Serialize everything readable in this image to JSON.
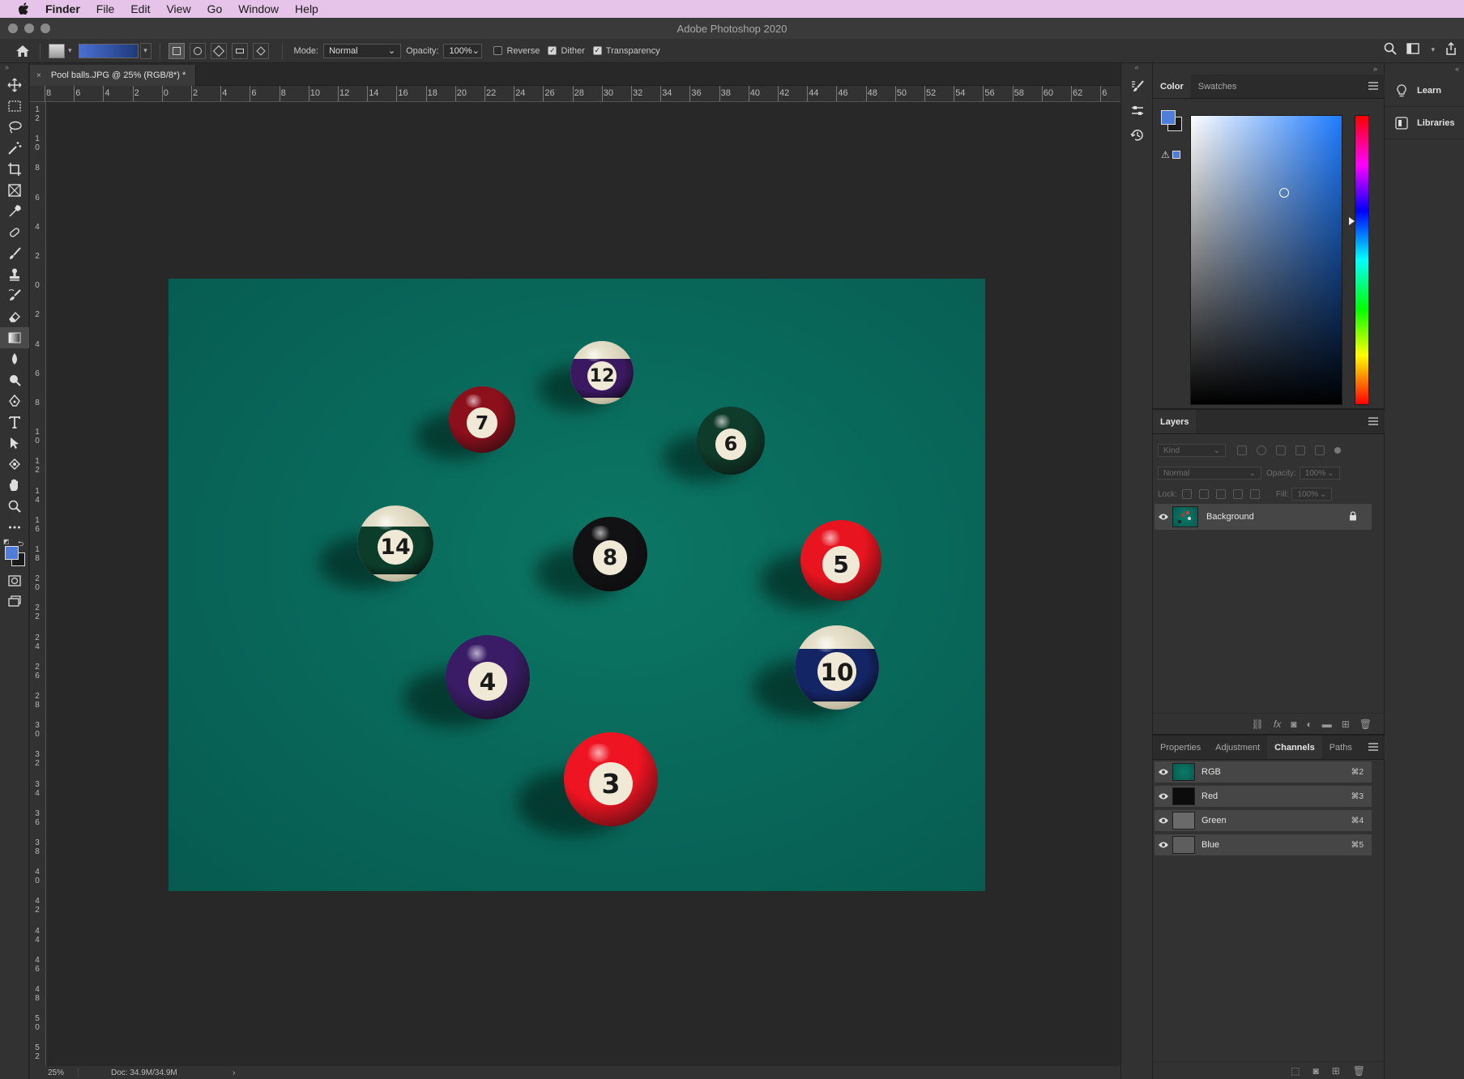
{
  "menubar": {
    "apple": "",
    "items": [
      "Finder",
      "File",
      "Edit",
      "View",
      "Go",
      "Window",
      "Help"
    ]
  },
  "window": {
    "title": "Adobe Photoshop 2020"
  },
  "options_bar": {
    "mode_label": "Mode:",
    "mode_value": "Normal",
    "opacity_label": "Opacity:",
    "opacity_value": "100%",
    "reverse_label": "Reverse",
    "reverse_checked": false,
    "dither_label": "Dither",
    "dither_checked": true,
    "transparency_label": "Transparency",
    "transparency_checked": true
  },
  "document": {
    "tab_title": "Pool balls.JPG @ 25% (RGB/8*) *",
    "close_glyph": "×"
  },
  "rulers": {
    "top": [
      "8",
      "6",
      "4",
      "2",
      "0",
      "2",
      "4",
      "6",
      "8",
      "10",
      "12",
      "14",
      "16",
      "18",
      "20",
      "22",
      "24",
      "26",
      "28",
      "30",
      "32",
      "34",
      "36",
      "38",
      "40",
      "42",
      "44",
      "46",
      "48",
      "50",
      "52",
      "54",
      "56",
      "58",
      "60",
      "62",
      "6"
    ],
    "left": [
      "12",
      "10",
      "8",
      "6",
      "4",
      "2",
      "0",
      "2",
      "4",
      "6",
      "8",
      "10",
      "12",
      "14",
      "16",
      "18",
      "20",
      "22",
      "24",
      "26",
      "28",
      "30",
      "32",
      "34",
      "36",
      "38",
      "40",
      "42",
      "44",
      "46",
      "48",
      "50",
      "52"
    ]
  },
  "image": {
    "balls": [
      {
        "number": "12",
        "type": "stripe",
        "color": "#3a1960"
      },
      {
        "number": "7",
        "type": "solid",
        "color": "#8c0f1c"
      },
      {
        "number": "6",
        "type": "solid",
        "color": "#0f3b2a"
      },
      {
        "number": "14",
        "type": "stripe",
        "color": "#0b3d2a"
      },
      {
        "number": "8",
        "type": "solid",
        "color": "#121214"
      },
      {
        "number": "5",
        "type": "solid",
        "color": "#e8141f"
      },
      {
        "number": "4",
        "type": "solid",
        "color": "#3a1c66"
      },
      {
        "number": "10",
        "type": "stripe",
        "color": "#142566"
      },
      {
        "number": "3",
        "type": "solid",
        "color": "#ef1422"
      }
    ]
  },
  "status": {
    "zoom": "25%",
    "doc": "Doc: 34.9M/34.9M",
    "arrow": "›"
  },
  "color_panel": {
    "tabs": [
      "Color",
      "Swatches"
    ],
    "active_tab": "Color",
    "foreground_color": "#4f7ddb",
    "background_color": "#1a1a1a",
    "gamut_warning": "⚠"
  },
  "layers_panel": {
    "title": "Layers",
    "kind_placeholder": "Kind",
    "blend_mode": "Normal",
    "opacity_label": "Opacity:",
    "opacity_value": "100%",
    "lock_label": "Lock:",
    "fill_label": "Fill:",
    "fill_value": "100%",
    "layers": [
      {
        "name": "Background",
        "locked": true,
        "visible": true
      }
    ]
  },
  "channels_panel": {
    "tabs": [
      "Properties",
      "Adjustment",
      "Channels",
      "Paths"
    ],
    "active_tab": "Channels",
    "channels": [
      {
        "name": "RGB",
        "shortcut": "⌘2"
      },
      {
        "name": "Red",
        "shortcut": "⌘3"
      },
      {
        "name": "Green",
        "shortcut": "⌘4"
      },
      {
        "name": "Blue",
        "shortcut": "⌘5"
      }
    ]
  },
  "side_panels": {
    "learn": "Learn",
    "libraries": "Libraries"
  }
}
